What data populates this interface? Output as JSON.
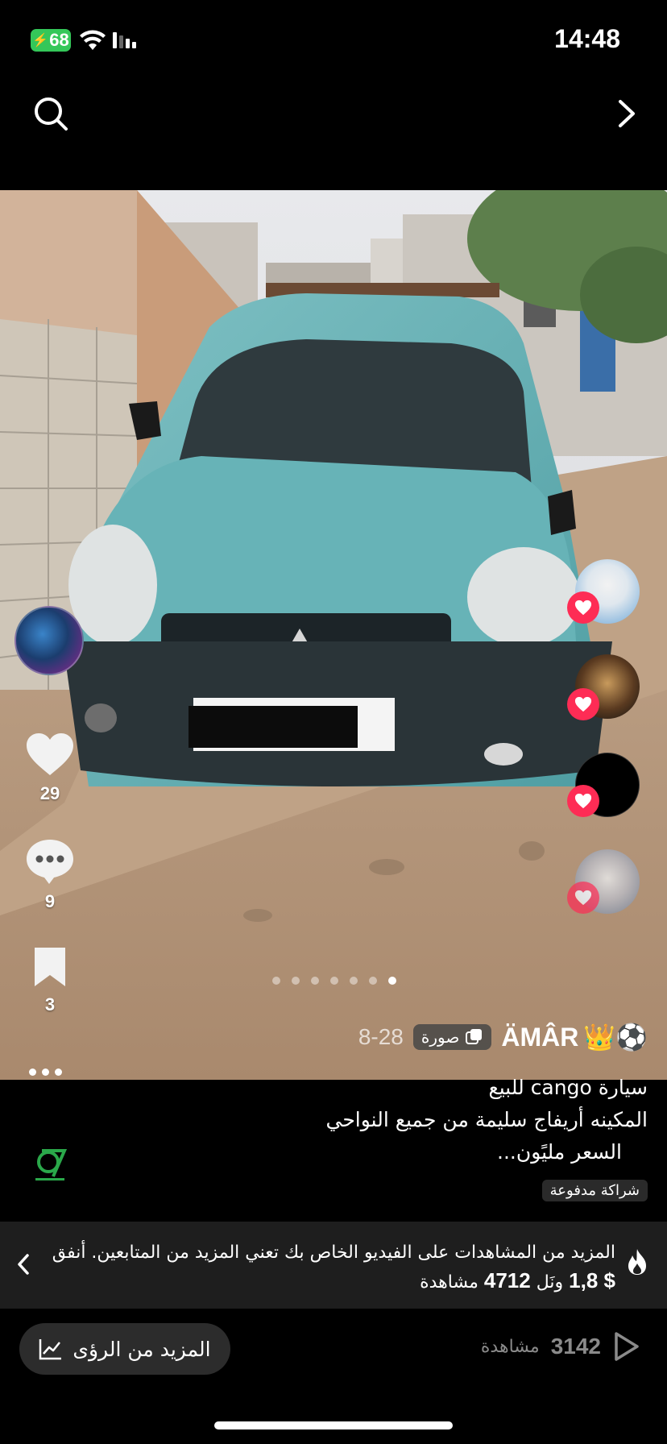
{
  "status_bar": {
    "time": "14:48",
    "battery": "68"
  },
  "post": {
    "username": "ÄMÂR",
    "username_emoji": "👑⚽",
    "date": "8-28",
    "media_type_label": "صورة",
    "caption_lines": [
      "سيارة cango للبيع",
      "المكينه أريفاج سليمة من جميع النواحي",
      "السعر مليًون..."
    ],
    "paid_partnership_label": "شراكة مدفوعة",
    "carousel": {
      "total": 7,
      "active_index": 6
    }
  },
  "actions": {
    "likes": "29",
    "comments": "9",
    "saves": "3"
  },
  "promo": {
    "text_line1": "المزيد من المشاهدات على الفيديو الخاص بك تعني المزيد من المتابعين. أنفق",
    "amount": "$ 1,8",
    "middle": "ونَل",
    "views_number": "4712",
    "views_label": "مشاهدة"
  },
  "bottom": {
    "insights_label": "المزيد من الرؤى",
    "views_count": "3142",
    "views_label": "مشاهدة"
  },
  "colors": {
    "accent": "#fe2c55",
    "battery": "#34c759"
  },
  "icons": [
    "search-icon",
    "chevron-right-icon",
    "heart-icon",
    "comment-icon",
    "bookmark-icon",
    "chevron-left-icon",
    "flame-icon",
    "chart-icon",
    "play-icon"
  ]
}
